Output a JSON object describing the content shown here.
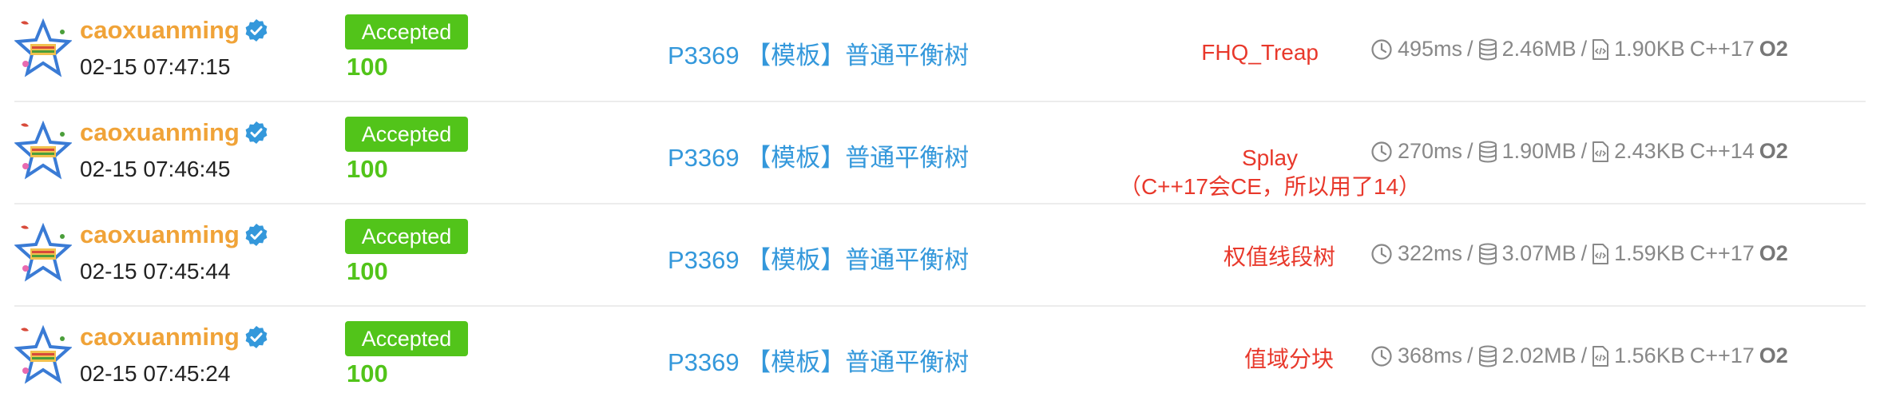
{
  "records": [
    {
      "username": "caoxuanming",
      "time": "02-15 07:47:15",
      "status": "Accepted",
      "score": "100",
      "problem": "P3369 【模板】普通平衡树",
      "note": "FHQ_Treap",
      "note2": "",
      "runtime": "495ms",
      "memory": "2.46MB",
      "code_size": "1.90KB",
      "language": "C++17",
      "opt": "O2"
    },
    {
      "username": "caoxuanming",
      "time": "02-15 07:46:45",
      "status": "Accepted",
      "score": "100",
      "problem": "P3369 【模板】普通平衡树",
      "note": "Splay",
      "note2": "（C++17会CE，所以用了14）",
      "runtime": "270ms",
      "memory": "1.90MB",
      "code_size": "2.43KB",
      "language": "C++14",
      "opt": "O2"
    },
    {
      "username": "caoxuanming",
      "time": "02-15 07:45:44",
      "status": "Accepted",
      "score": "100",
      "problem": "P3369 【模板】普通平衡树",
      "note": "权值线段树",
      "note2": "",
      "runtime": "322ms",
      "memory": "3.07MB",
      "code_size": "1.59KB",
      "language": "C++17",
      "opt": "O2"
    },
    {
      "username": "caoxuanming",
      "time": "02-15 07:45:24",
      "status": "Accepted",
      "score": "100",
      "problem": "P3369 【模板】普通平衡树",
      "note": "值域分块",
      "note2": "",
      "runtime": "368ms",
      "memory": "2.02MB",
      "code_size": "1.56KB",
      "language": "C++17",
      "opt": "O2"
    }
  ],
  "separator": "/",
  "icons": {
    "clock": "clock-icon",
    "memory": "database-icon",
    "code": "code-file-icon",
    "verified": "verified-badge-icon"
  },
  "colors": {
    "username": "#f0a338",
    "accepted_bg": "#52c41a",
    "score": "#52c41a",
    "problem_link": "#3498db",
    "annotation": "#e8382b",
    "verified": "#3498db"
  }
}
